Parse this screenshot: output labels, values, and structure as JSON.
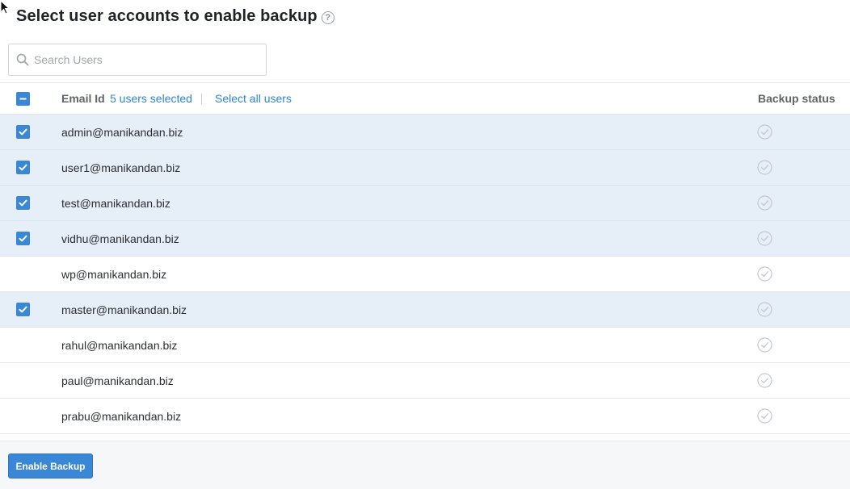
{
  "header": {
    "title": "Select user accounts to enable backup",
    "help_icon": "question-circle-icon",
    "help_glyph": "?"
  },
  "search": {
    "placeholder": "Search Users",
    "value": "",
    "icon": "search-icon"
  },
  "table": {
    "header_checkbox_state": "partial",
    "email_header": "Email Id",
    "selected_count_text": "5 users selected",
    "select_all_text": "Select all users",
    "status_header": "Backup status",
    "rows": [
      {
        "email": "admin@manikandan.biz",
        "selected": true,
        "status_icon": "check-circle-icon"
      },
      {
        "email": "user1@manikandan.biz",
        "selected": true,
        "status_icon": "check-circle-icon"
      },
      {
        "email": "test@manikandan.biz",
        "selected": true,
        "status_icon": "check-circle-icon"
      },
      {
        "email": "vidhu@manikandan.biz",
        "selected": true,
        "status_icon": "check-circle-icon"
      },
      {
        "email": "wp@manikandan.biz",
        "selected": false,
        "status_icon": "check-circle-icon"
      },
      {
        "email": "master@manikandan.biz",
        "selected": true,
        "status_icon": "check-circle-icon"
      },
      {
        "email": "rahul@manikandan.biz",
        "selected": false,
        "status_icon": "check-circle-icon"
      },
      {
        "email": "paul@manikandan.biz",
        "selected": false,
        "status_icon": "check-circle-icon"
      },
      {
        "email": "prabu@manikandan.biz",
        "selected": false,
        "status_icon": "check-circle-icon"
      }
    ]
  },
  "footer": {
    "enable_label": "Enable Backup"
  },
  "colors": {
    "accent": "#3a87d6",
    "link": "#2f83d3",
    "selected_row_bg": "#e6eef8",
    "footer_bg": "#f6f7f8"
  }
}
